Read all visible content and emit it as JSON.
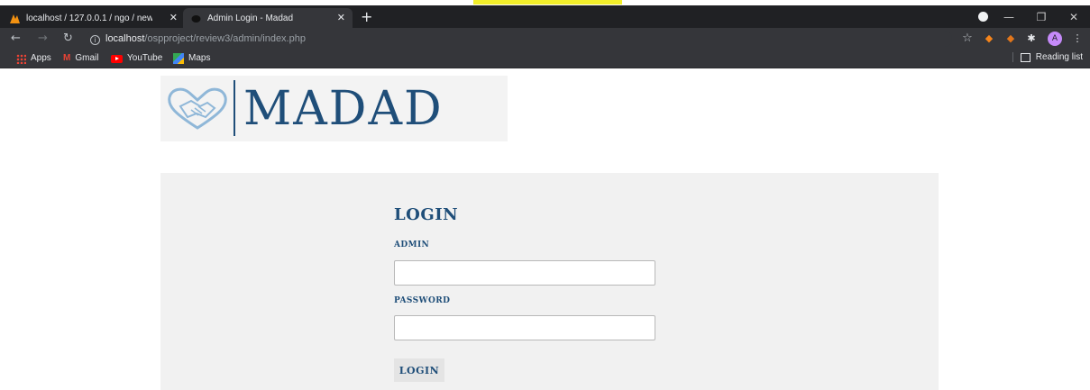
{
  "browser": {
    "tabs": [
      {
        "title": "localhost / 127.0.0.1 / ngo / new",
        "close": "✕",
        "active": false
      },
      {
        "title": "Admin Login - Madad",
        "close": "✕",
        "active": true
      }
    ],
    "new_tab": "+",
    "window_controls": {
      "minimize": "—",
      "restore": "❐",
      "close": "✕"
    },
    "url_host": "localhost",
    "url_path": "/ospproject/review3/admin/index.php",
    "avatar_letter": "A",
    "bookmarks": [
      {
        "label": "Apps",
        "icon": "apps-grid-icon"
      },
      {
        "label": "Gmail",
        "icon": "gmail-icon"
      },
      {
        "label": "YouTube",
        "icon": "youtube-icon"
      },
      {
        "label": "Maps",
        "icon": "maps-icon"
      }
    ],
    "reading_list": "Reading list"
  },
  "logo": {
    "wordmark": "MADAD",
    "color": "#1f4e79"
  },
  "login": {
    "heading": "LOGIN",
    "admin_label": "ADMIN",
    "admin_value": "",
    "password_label": "PASSWORD",
    "password_value": "",
    "submit_label": "LOGIN"
  },
  "colors": {
    "accent": "#1f4e79",
    "panel": "#f1f1f1",
    "highlight": "#f2ef2a"
  }
}
